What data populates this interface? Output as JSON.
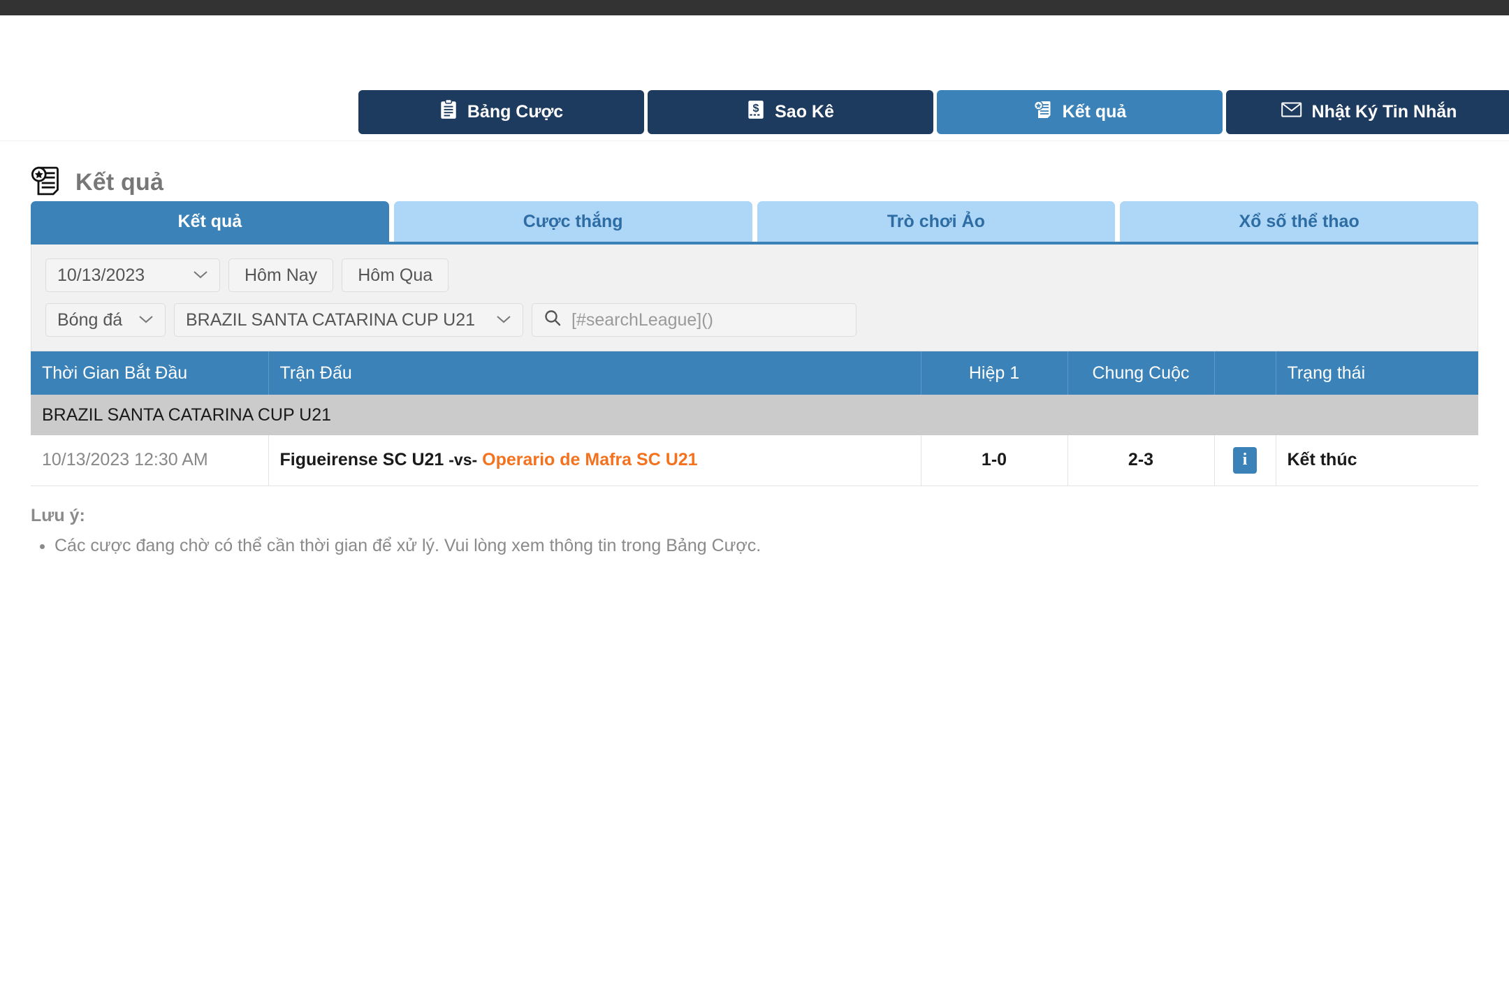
{
  "nav": {
    "items": [
      {
        "label": "Bảng Cược",
        "icon": "clipboard-icon",
        "active": false
      },
      {
        "label": "Sao Kê",
        "icon": "statement-icon",
        "active": false
      },
      {
        "label": "Kết quả",
        "icon": "results-icon",
        "active": true
      },
      {
        "label": "Nhật Ký Tin Nhắn",
        "icon": "envelope-icon",
        "active": false
      }
    ]
  },
  "page": {
    "title": "Kết quả",
    "icon": "results-icon"
  },
  "tabs": [
    {
      "label": "Kết quả",
      "active": true
    },
    {
      "label": "Cược thắng",
      "active": false
    },
    {
      "label": "Trò chơi Ảo",
      "active": false
    },
    {
      "label": "Xổ số thể thao",
      "active": false
    }
  ],
  "filters": {
    "date_value": "10/13/2023",
    "today_label": "Hôm Nay",
    "yesterday_label": "Hôm Qua",
    "sport_value": "Bóng đá",
    "league_value": "BRAZIL SANTA CATARINA CUP U21",
    "search_placeholder": "[#searchLeague]()",
    "search_value": ""
  },
  "table": {
    "columns": {
      "time": "Thời Gian Bắt Đầu",
      "match": "Trận Đấu",
      "half1": "Hiệp 1",
      "fulltime": "Chung Cuộc",
      "info": "",
      "status": "Trạng thái"
    },
    "league_group": "BRAZIL SANTA CATARINA CUP U21",
    "rows": [
      {
        "time": "10/13/2023 12:30 AM",
        "home": "Figueirense SC U21",
        "separator": "-vs-",
        "away": "Operario de Mafra SC U21",
        "half1": "1-0",
        "fulltime": "2-3",
        "info_icon": "info-icon",
        "status": "Kết thúc"
      }
    ]
  },
  "note": {
    "heading": "Lưu ý:",
    "items": [
      "Các cược đang chờ có thể cần thời gian để xử lý. Vui lòng xem thông tin trong Bảng Cược."
    ]
  },
  "colors": {
    "nav_dark": "#1d3a5f",
    "accent_blue": "#3b82b8",
    "tab_light": "#aed6f7",
    "away_orange": "#f4721e",
    "group_gray": "#cbcbcb",
    "topbar": "#333333"
  }
}
